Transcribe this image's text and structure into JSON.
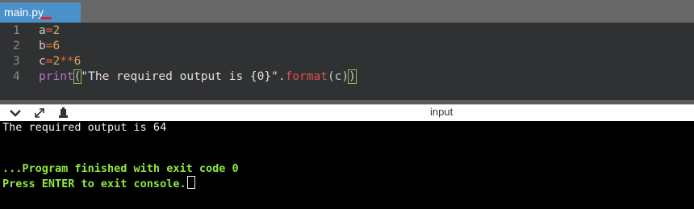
{
  "tab": {
    "label": "main.py"
  },
  "editor": {
    "lines": [
      {
        "number": "1"
      },
      {
        "number": "2"
      },
      {
        "number": "3"
      },
      {
        "number": "4"
      }
    ],
    "tokens": {
      "l1_a": "a",
      "l1_eq": "=",
      "l1_num": "2",
      "l2_b": "b",
      "l2_eq": "=",
      "l2_num": "6",
      "l3_c": "c",
      "l3_eq": "=",
      "l3_n1": "2",
      "l3_op": "**",
      "l3_n2": "6",
      "l4_print": "print",
      "l4_open": "(",
      "l4_str": "\"The required output is {0}\"",
      "l4_dot": ".",
      "l4_format": "format",
      "l4_inner": "(c)",
      "l4_close": ")"
    }
  },
  "console": {
    "title": "input",
    "output_line": "The required output is 64",
    "finish_line": "...Program finished with exit code 0",
    "exit_line": "Press ENTER to exit console."
  },
  "icons": {
    "collapse": "chevron-down-icon",
    "expand": "expand-arrows-icon",
    "clear": "clear-console-icon"
  },
  "colors": {
    "tab_active": "#4a90c9",
    "editor_bg": "#2f3133",
    "console_bg": "#000000",
    "console_green": "#8fe93c"
  }
}
